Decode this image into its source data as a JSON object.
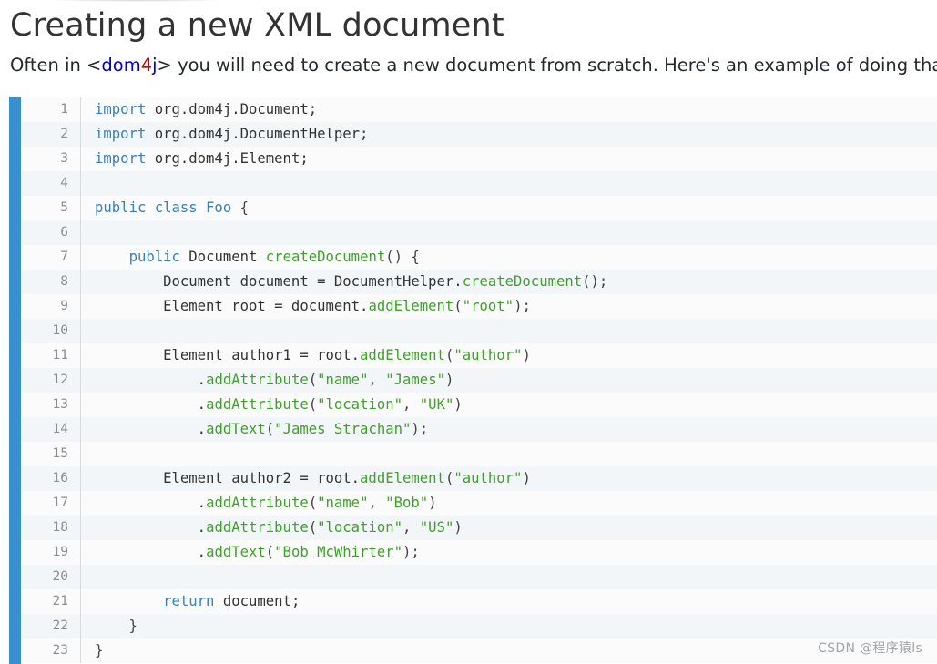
{
  "heading": "Creating a new XML document",
  "intro": {
    "before": "Often in <",
    "brand_part1": "dom",
    "brand_part2": "4",
    "brand_part3": "j",
    "after": "> you will need to create a new document from scratch. Here's an example of doing that."
  },
  "colors": {
    "gutter_bar": "#3a8fcf",
    "keyword": "#3a7fb5",
    "method_and_string": "#3fa02b",
    "brand_dom": "#0000cc",
    "brand_4": "#cc0000"
  },
  "code": {
    "language": "java",
    "lines": [
      [
        {
          "t": "import",
          "c": "k"
        },
        {
          "t": " org.dom4j.Document;",
          "c": ""
        }
      ],
      [
        {
          "t": "import",
          "c": "k"
        },
        {
          "t": " org.dom4j.DocumentHelper;",
          "c": ""
        }
      ],
      [
        {
          "t": "import",
          "c": "k"
        },
        {
          "t": " org.dom4j.Element;",
          "c": ""
        }
      ],
      [],
      [
        {
          "t": "public class Foo",
          "c": "k"
        },
        {
          "t": " {",
          "c": "p"
        }
      ],
      [],
      [
        {
          "t": "    ",
          "c": ""
        },
        {
          "t": "public",
          "c": "k"
        },
        {
          "t": " Document ",
          "c": ""
        },
        {
          "t": "createDocument",
          "c": "m"
        },
        {
          "t": "() {",
          "c": "p"
        }
      ],
      [
        {
          "t": "        Document document = DocumentHelper.",
          "c": ""
        },
        {
          "t": "createDocument",
          "c": "m"
        },
        {
          "t": "();",
          "c": "p"
        }
      ],
      [
        {
          "t": "        Element root = document.",
          "c": ""
        },
        {
          "t": "addElement",
          "c": "m"
        },
        {
          "t": "(",
          "c": "p"
        },
        {
          "t": "\"root\"",
          "c": "s"
        },
        {
          "t": ");",
          "c": "p"
        }
      ],
      [],
      [
        {
          "t": "        Element author1 = root.",
          "c": ""
        },
        {
          "t": "addElement",
          "c": "m"
        },
        {
          "t": "(",
          "c": "p"
        },
        {
          "t": "\"author\"",
          "c": "s"
        },
        {
          "t": ")",
          "c": "p"
        }
      ],
      [
        {
          "t": "            .",
          "c": ""
        },
        {
          "t": "addAttribute",
          "c": "m"
        },
        {
          "t": "(",
          "c": "p"
        },
        {
          "t": "\"name\"",
          "c": "s"
        },
        {
          "t": ", ",
          "c": "p"
        },
        {
          "t": "\"James\"",
          "c": "s"
        },
        {
          "t": ")",
          "c": "p"
        }
      ],
      [
        {
          "t": "            .",
          "c": ""
        },
        {
          "t": "addAttribute",
          "c": "m"
        },
        {
          "t": "(",
          "c": "p"
        },
        {
          "t": "\"location\"",
          "c": "s"
        },
        {
          "t": ", ",
          "c": "p"
        },
        {
          "t": "\"UK\"",
          "c": "s"
        },
        {
          "t": ")",
          "c": "p"
        }
      ],
      [
        {
          "t": "            .",
          "c": ""
        },
        {
          "t": "addText",
          "c": "m"
        },
        {
          "t": "(",
          "c": "p"
        },
        {
          "t": "\"James Strachan\"",
          "c": "s"
        },
        {
          "t": ");",
          "c": "p"
        }
      ],
      [],
      [
        {
          "t": "        Element author2 = root.",
          "c": ""
        },
        {
          "t": "addElement",
          "c": "m"
        },
        {
          "t": "(",
          "c": "p"
        },
        {
          "t": "\"author\"",
          "c": "s"
        },
        {
          "t": ")",
          "c": "p"
        }
      ],
      [
        {
          "t": "            .",
          "c": ""
        },
        {
          "t": "addAttribute",
          "c": "m"
        },
        {
          "t": "(",
          "c": "p"
        },
        {
          "t": "\"name\"",
          "c": "s"
        },
        {
          "t": ", ",
          "c": "p"
        },
        {
          "t": "\"Bob\"",
          "c": "s"
        },
        {
          "t": ")",
          "c": "p"
        }
      ],
      [
        {
          "t": "            .",
          "c": ""
        },
        {
          "t": "addAttribute",
          "c": "m"
        },
        {
          "t": "(",
          "c": "p"
        },
        {
          "t": "\"location\"",
          "c": "s"
        },
        {
          "t": ", ",
          "c": "p"
        },
        {
          "t": "\"US\"",
          "c": "s"
        },
        {
          "t": ")",
          "c": "p"
        }
      ],
      [
        {
          "t": "            .",
          "c": ""
        },
        {
          "t": "addText",
          "c": "m"
        },
        {
          "t": "(",
          "c": "p"
        },
        {
          "t": "\"Bob McWhirter\"",
          "c": "s"
        },
        {
          "t": ");",
          "c": "p"
        }
      ],
      [],
      [
        {
          "t": "        ",
          "c": ""
        },
        {
          "t": "return",
          "c": "k"
        },
        {
          "t": " document;",
          "c": ""
        }
      ],
      [
        {
          "t": "    }",
          "c": "p"
        }
      ],
      [
        {
          "t": "}",
          "c": "p"
        }
      ]
    ]
  },
  "watermark": "CSDN @程序猿ls"
}
